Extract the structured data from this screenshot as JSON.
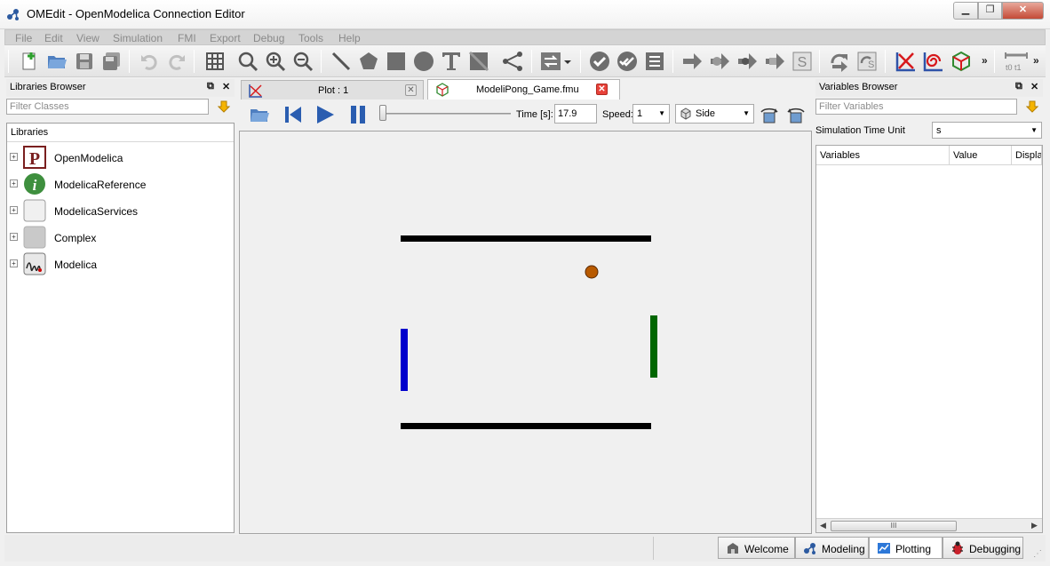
{
  "window": {
    "title": "OMEdit - OpenModelica Connection Editor"
  },
  "menu": [
    "File",
    "Edit",
    "View",
    "Simulation",
    "FMI",
    "Export",
    "Debug",
    "Tools",
    "Help"
  ],
  "libraries_browser": {
    "title": "Libraries Browser",
    "filter_placeholder": "Filter Classes",
    "header": "Libraries",
    "items": [
      {
        "label": "OpenModelica",
        "icon": "openmodelica-p-icon"
      },
      {
        "label": "ModelicaReference",
        "icon": "info-icon"
      },
      {
        "label": "ModelicaServices",
        "icon": "package-icon"
      },
      {
        "label": "Complex",
        "icon": "package-icon"
      },
      {
        "label": "Modelica",
        "icon": "modelica-icon"
      }
    ]
  },
  "tabs": [
    {
      "label": "Plot : 1",
      "icon": "plot-icon",
      "active": false
    },
    {
      "label": "ModeliPong_Game.fmu",
      "icon": "cube-icon",
      "active": true
    }
  ],
  "animation": {
    "time_label": "Time [s]:",
    "time_value": "17.9",
    "speed_label": "Speed:",
    "speed_value": "1",
    "view_value": "Side"
  },
  "variables_browser": {
    "title": "Variables Browser",
    "filter_placeholder": "Filter Variables",
    "time_unit_label": "Simulation Time Unit",
    "time_unit_value": "s",
    "columns": [
      "Variables",
      "Value",
      "Display"
    ],
    "scroll_grip": "III"
  },
  "perspectives": [
    {
      "label": "Welcome",
      "icon": "welcome-icon",
      "active": false
    },
    {
      "label": "Modeling",
      "icon": "modeling-icon",
      "active": false
    },
    {
      "label": "Plotting",
      "icon": "plotting-icon",
      "active": true
    },
    {
      "label": "Debugging",
      "icon": "bug-icon",
      "active": false
    }
  ],
  "scene_colors": {
    "wall": "#000000",
    "left_paddle": "#0000cc",
    "right_paddle": "#006600",
    "ball": "#b85a00"
  }
}
